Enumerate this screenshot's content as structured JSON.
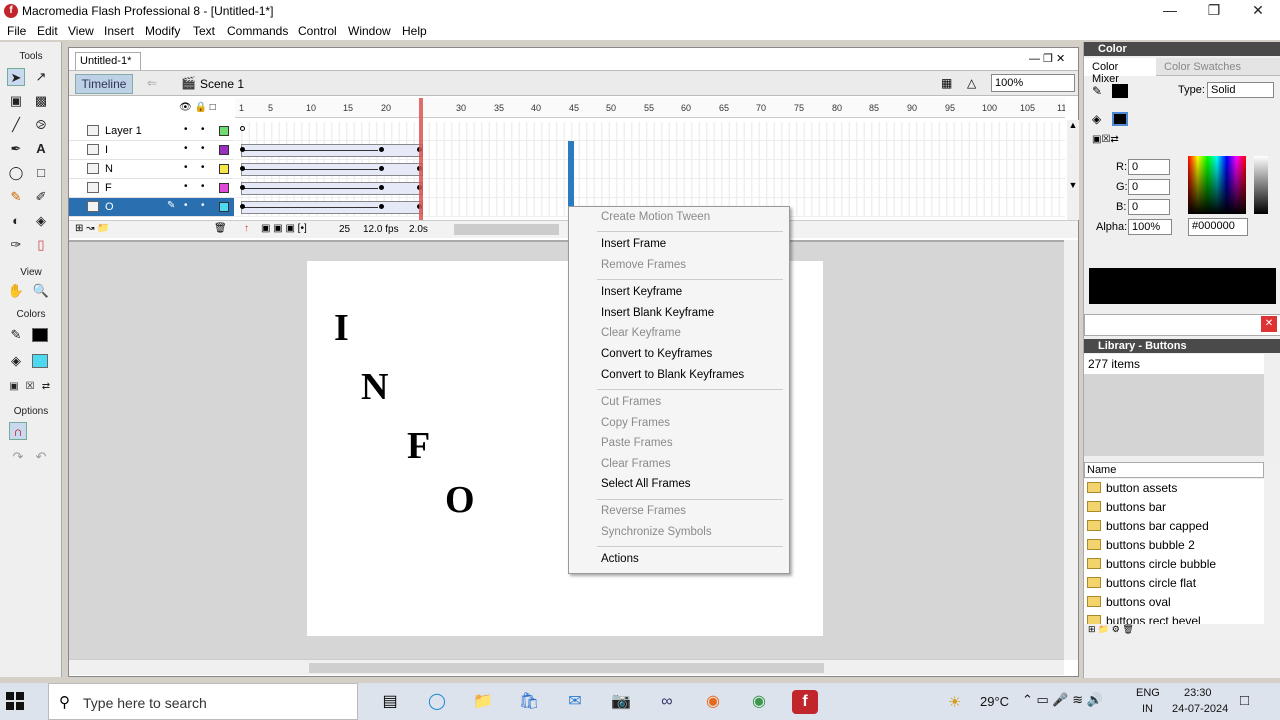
{
  "window": {
    "title": "Macromedia Flash Professional 8 - [Untitled-1*]",
    "app_icon_letter": "f"
  },
  "menu": [
    "File",
    "Edit",
    "View",
    "Insert",
    "Modify",
    "Text",
    "Commands",
    "Control",
    "Window",
    "Help"
  ],
  "tools": {
    "header": "Tools",
    "view_label": "View",
    "colors_label": "Colors",
    "options_label": "Options"
  },
  "document": {
    "tab": "Untitled-1*",
    "timeline_btn": "Timeline",
    "scene": "Scene 1",
    "zoom": "100%",
    "layers": [
      {
        "name": "Layer 1",
        "color": "#6fdc6f"
      },
      {
        "name": "I",
        "color": "#9b2fbf"
      },
      {
        "name": "N",
        "color": "#f4e64b"
      },
      {
        "name": "F",
        "color": "#e04cd8"
      },
      {
        "name": "O",
        "color": "#4fd9f0"
      }
    ],
    "ruler_ticks": [
      "1",
      "5",
      "10",
      "15",
      "20",
      "",
      "30",
      "35",
      "40",
      "45",
      "50",
      "55",
      "60",
      "65",
      "70",
      "75",
      "80",
      "85",
      "90",
      "95",
      "100",
      "105",
      "11"
    ],
    "footer": {
      "frame": "25",
      "fps": "12.0 fps",
      "time": "2.0s"
    },
    "stage_letters": [
      "I",
      "N",
      "F",
      "O"
    ]
  },
  "context_menu": [
    {
      "label": "Create Motion Tween",
      "enabled": false
    },
    {
      "sep": true
    },
    {
      "label": "Insert Frame",
      "enabled": true
    },
    {
      "label": "Remove Frames",
      "enabled": false
    },
    {
      "sep": true
    },
    {
      "label": "Insert Keyframe",
      "enabled": true
    },
    {
      "label": "Insert Blank Keyframe",
      "enabled": true
    },
    {
      "label": "Clear Keyframe",
      "enabled": false
    },
    {
      "label": "Convert to Keyframes",
      "enabled": true
    },
    {
      "label": "Convert to Blank Keyframes",
      "enabled": true
    },
    {
      "sep": true
    },
    {
      "label": "Cut Frames",
      "enabled": false
    },
    {
      "label": "Copy Frames",
      "enabled": false
    },
    {
      "label": "Paste Frames",
      "enabled": false
    },
    {
      "label": "Clear Frames",
      "enabled": false
    },
    {
      "label": "Select All Frames",
      "enabled": true
    },
    {
      "sep": true
    },
    {
      "label": "Reverse Frames",
      "enabled": false
    },
    {
      "label": "Synchronize Symbols",
      "enabled": false
    },
    {
      "sep": true
    },
    {
      "label": "Actions",
      "enabled": true
    }
  ],
  "color_panel": {
    "title": "Color",
    "tab_mixer": "Color Mixer",
    "tab_swatches": "Color Swatches",
    "type_label": "Type:",
    "type_value": "Solid",
    "r_label": "R:",
    "r": "0",
    "g_label": "G:",
    "g": "0",
    "b_label": "B:",
    "b": "0",
    "alpha_label": "Alpha:",
    "alpha": "100%",
    "hex": "#000000"
  },
  "library": {
    "title": "Library - Buttons",
    "count": "277 items",
    "col_name": "Name",
    "items": [
      "button assets",
      "buttons bar",
      "buttons bar capped",
      "buttons bubble 2",
      "buttons circle bubble",
      "buttons circle flat",
      "buttons oval",
      "buttons rect bevel"
    ]
  },
  "taskbar": {
    "search_placeholder": "Type here to search",
    "temp": "29°C",
    "lang1": "ENG",
    "lang2": "IN",
    "time": "23:30",
    "date": "24-07-2024"
  }
}
